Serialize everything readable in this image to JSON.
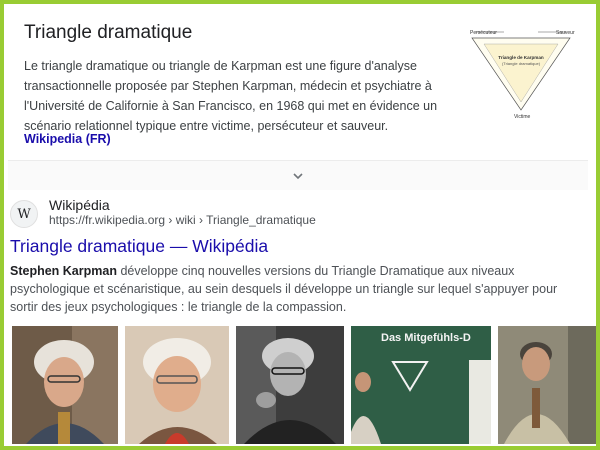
{
  "knowledge_panel": {
    "title": "Triangle dramatique",
    "description": "Le triangle dramatique ou triangle de Karpman est une figure d'analyse transactionnelle proposée par Stephen Karpman, médecin et psychiatre à l'Université de Californie à San Francisco, en 1968 qui met en évidence un scénario relationnel typique entre victime, persécuteur et sauveur.",
    "source_label": "Wikipedia (FR)",
    "diagram": {
      "top_left": "Persécuteur",
      "top_right": "Sauveur",
      "bottom": "Victime",
      "center_title": "Triangle de Karpman",
      "center_sub": "(Triangle dramatique)"
    },
    "expand_icon": "chevron-down-icon"
  },
  "result": {
    "site_icon_letter": "W",
    "site_name": "Wikipédia",
    "url": "https://fr.wikipedia.org › wiki › Triangle_dramatique",
    "title": "Triangle dramatique — Wikipédia",
    "snippet_bold": "Stephen Karpman",
    "snippet_rest": " développe cinq nouvelles versions du Triangle Dramatique aux niveaux psychologique et scénaristique, au sein desquels il développe un triangle sur lequel s'appuyer pour sortir des jeux psychologiques : le triangle de la compassion."
  },
  "images": [
    {
      "kind": "portrait"
    },
    {
      "kind": "portrait"
    },
    {
      "kind": "portrait-bw"
    },
    {
      "kind": "chalkboard",
      "caption": "Das Mitgefühls-D"
    },
    {
      "kind": "portrait"
    }
  ],
  "colors": {
    "frame": "#99cc33",
    "link": "#1a0dab",
    "chalkboard": "#2f5e46"
  }
}
